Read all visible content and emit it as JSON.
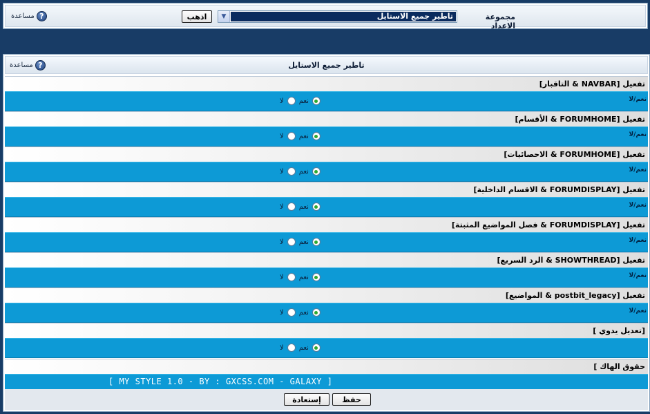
{
  "top": {
    "help_label": "مساعدة",
    "help_icon": "?",
    "setting_group_label": "مجموعة الاعداد",
    "selected_group": "تاطير جميع الاستايل",
    "dropdown_arrow": "▼",
    "go_button": "اذهب"
  },
  "main": {
    "title": "تاطير جميع الاستايل",
    "help_label": "مساعدة",
    "help_icon": "?",
    "options": [
      {
        "title": "[التاقبار & NAVBAR] تفعيل",
        "desc": "نعم/لا",
        "yes": "نعم",
        "no": "لا",
        "selected": "yes"
      },
      {
        "title": "[الأقسام & FORUMHOME] تفعيل",
        "desc": "نعم/لا",
        "yes": "نعم",
        "no": "لا",
        "selected": "yes"
      },
      {
        "title": "[الاحصائيات & FORUMHOME] تفعيل",
        "desc": "نعم/لا",
        "yes": "نعم",
        "no": "لا",
        "selected": "yes"
      },
      {
        "title": "[الاقسام الداخلية & FORUMDISPLAY] تفعيل",
        "desc": "نعم/لا",
        "yes": "نعم",
        "no": "لا",
        "selected": "yes"
      },
      {
        "title": "[فصل المواضيع المثبتة & FORUMDISPLAY] تفعيل",
        "desc": "نعم/لا",
        "yes": "نعم",
        "no": "لا",
        "selected": "yes"
      },
      {
        "title": "[الرد السريع & SHOWTHREAD] تفعيل",
        "desc": "نعم/لا",
        "yes": "نعم",
        "no": "لا",
        "selected": "yes"
      },
      {
        "title": "[المواضيع & postbit_legacy] تفعيل",
        "desc": "نعم/لا",
        "yes": "نعم",
        "no": "لا",
        "selected": "yes"
      },
      {
        "title": "[ تعديل يدوي]",
        "desc": "",
        "yes": "نعم",
        "no": "لا",
        "selected": "yes"
      }
    ],
    "credits_title": "[ حقوق الهاك",
    "credits_text": "[ MY STYLE 1.0 - BY : GXCSS.COM - GALAXY ]",
    "save_button": "حفظ",
    "restore_button": "إستعادة"
  }
}
